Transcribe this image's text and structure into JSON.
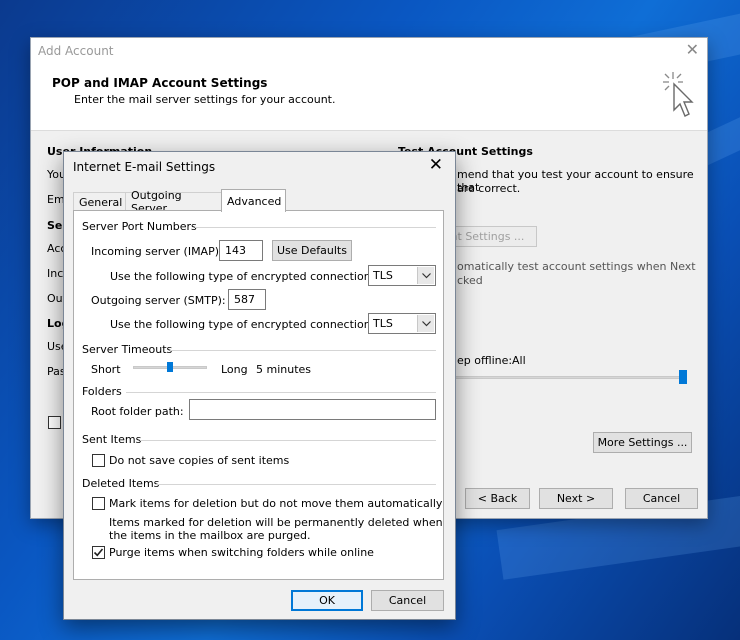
{
  "outer": {
    "title": "Add Account",
    "close": "✕",
    "header_title": "POP and IMAP Account Settings",
    "header_subtitle": "Enter the mail server settings for your account.",
    "user_information": "User Information",
    "you_fragment": "You",
    "email_fragment": "Ema",
    "server_fragment": "Ser",
    "account_type_fragment": "Acc",
    "incoming_fragment": "Inco",
    "outgoing_fragment": "Out",
    "logon_fragment": "Log",
    "user_fragment": "Use",
    "password_fragment": "Pas",
    "test_settings_title": "Test Account Settings",
    "test_line1": "mend that you test your account to ensure that",
    "test_line2": "are correct.",
    "test_button": "unt Settings ...",
    "auto_test_line1": "omatically test account settings when Next",
    "auto_test_line2": "cked",
    "keep_offline_label": "ep offline:",
    "keep_offline_value": "All",
    "keep_offline_level": 1.0,
    "more_settings": "More Settings ...",
    "back": "< Back",
    "next": "Next >",
    "cancel": "Cancel"
  },
  "inner": {
    "title": "Internet E-mail Settings",
    "close": "✕",
    "tabs": [
      {
        "label": "General"
      },
      {
        "label": "Outgoing Server"
      },
      {
        "label": "Advanced",
        "active": true
      }
    ],
    "server_port_numbers": "Server Port Numbers",
    "incoming_label": "Incoming server (IMAP):",
    "incoming_value": "143",
    "use_defaults": "Use Defaults",
    "encrypt_label_1": "Use the following type of encrypted connection:",
    "encrypt_value_1": "TLS",
    "outgoing_label": "Outgoing server (SMTP):",
    "outgoing_value": "587",
    "encrypt_label_2": "Use the following type of encrypted connection:",
    "encrypt_value_2": "TLS",
    "server_timeouts": "Server Timeouts",
    "timeout_short": "Short",
    "timeout_long": "Long",
    "timeout_value": "5 minutes",
    "timeout_level": 0.5,
    "folders": "Folders",
    "root_folder_label": "Root folder path:",
    "root_folder_value": "",
    "sent_items": "Sent Items",
    "do_not_save": "Do not save copies of sent items",
    "do_not_save_checked": false,
    "deleted_items": "Deleted Items",
    "mark_items": "Mark items for deletion but do not move them automatically",
    "mark_items_checked": false,
    "mark_note_1": "Items marked for deletion will be permanently deleted when",
    "mark_note_2": "the items in the mailbox are purged.",
    "purge_items": "Purge items when switching folders while online",
    "purge_items_checked": true,
    "ok": "OK",
    "cancel": "Cancel"
  },
  "colors": {
    "accent": "#0078d7",
    "desktop": "#0a57c2"
  }
}
